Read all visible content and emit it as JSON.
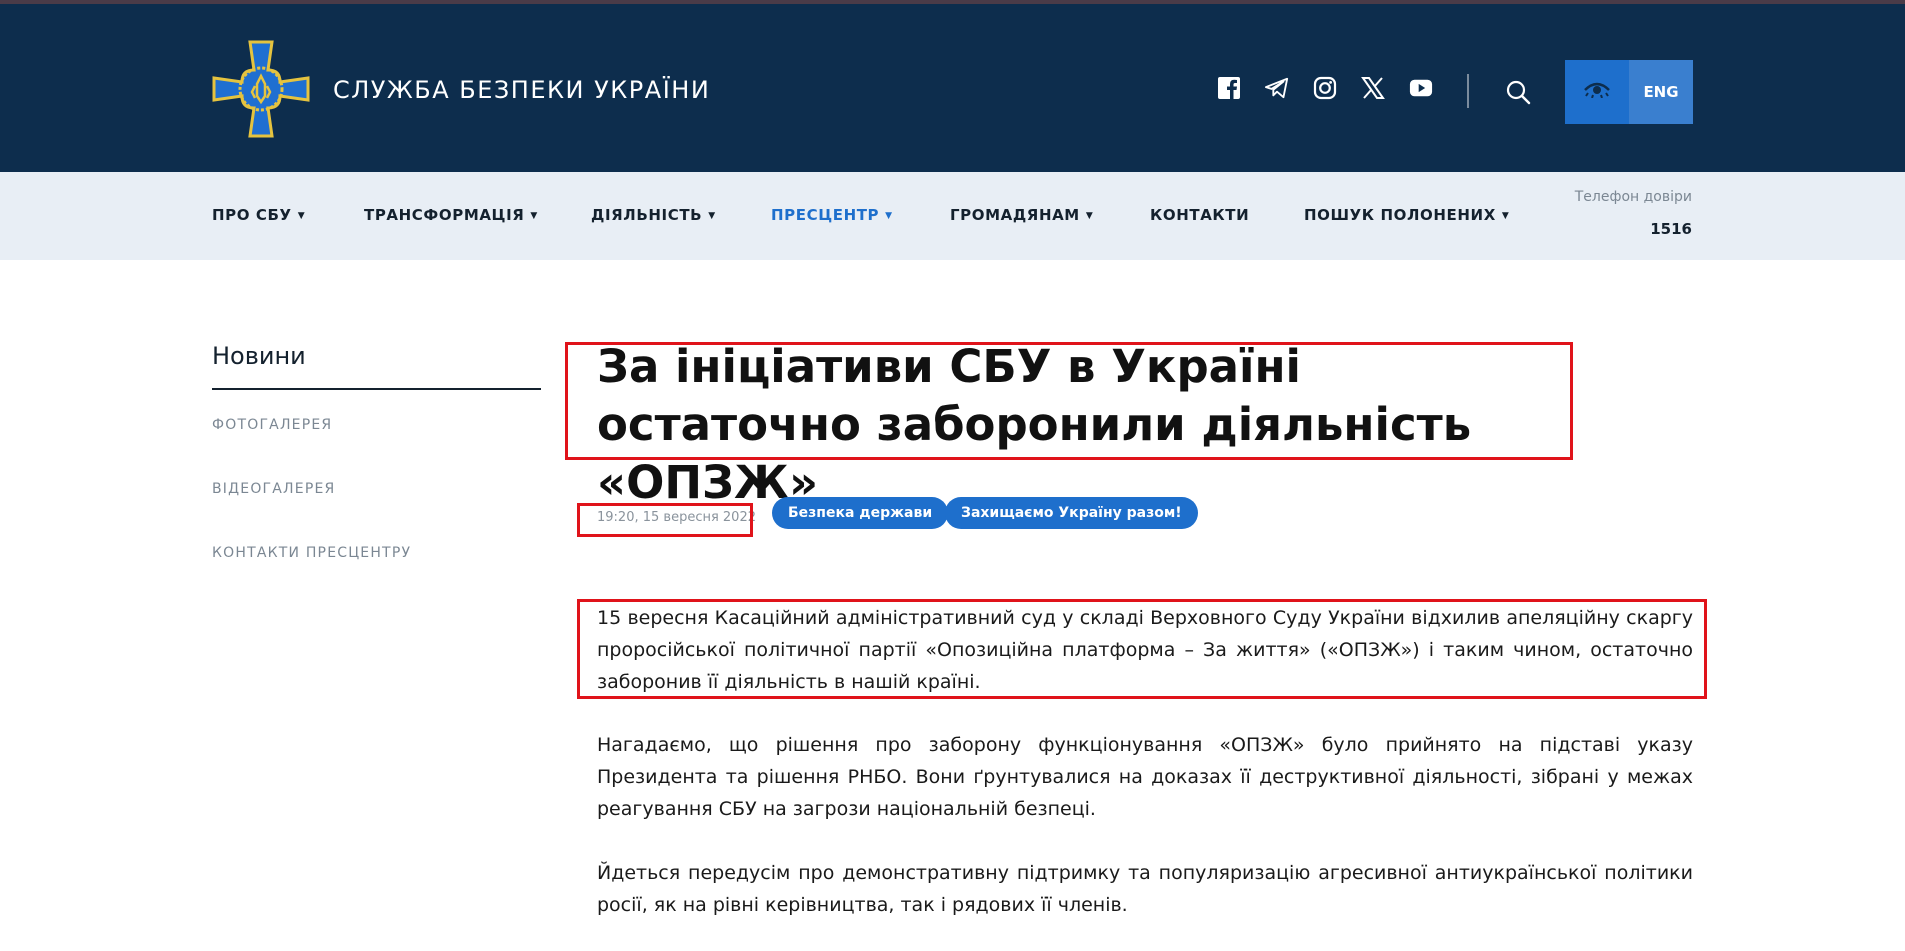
{
  "header": {
    "site_title": "СЛУЖБА БЕЗПЕКИ УКРАЇНИ",
    "logo_icon": "sbu-emblem-icon",
    "socials": [
      "facebook-icon",
      "telegram-icon",
      "instagram-icon",
      "x-icon",
      "youtube-icon"
    ],
    "search_icon": "search-icon",
    "accessibility_icon": "eye-icon",
    "lang_label": "ENG",
    "colors": {
      "header_bg": "#0d2d4d",
      "accent": "#1e6fcc",
      "nav_bg": "#e8eef5",
      "highlight": "#e0131a"
    }
  },
  "nav": {
    "items": [
      {
        "label": "ПРО СБУ",
        "dropdown": true
      },
      {
        "label": "ТРАНСФОРМАЦІЯ",
        "dropdown": true
      },
      {
        "label": "ДІЯЛЬНІСТЬ",
        "dropdown": true
      },
      {
        "label": "ПРЕСЦЕНТР",
        "dropdown": true,
        "active": true
      },
      {
        "label": "ГРОМАДЯНАМ",
        "dropdown": true
      },
      {
        "label": "КОНТАКТИ",
        "dropdown": false
      },
      {
        "label": "ПОШУК ПОЛОНЕНИХ",
        "dropdown": true
      }
    ],
    "trust_label": "Телефон довіри",
    "trust_number": "1516"
  },
  "sidebar": {
    "title": "Новини",
    "links": [
      "ФОТОГАЛЕРЕЯ",
      "ВІДЕОГАЛЕРЕЯ",
      "КОНТАКТИ ПРЕСЦЕНТРУ"
    ]
  },
  "article": {
    "title": "За ініціативи СБУ в Україні остаточно заборонили діяльність «ОПЗЖ»",
    "date": "19:20, 15 вересня 2022",
    "tags": [
      "Безпека держави",
      "Захищаємо Україну разом!"
    ],
    "paragraphs": [
      "15 вересня Касаційний адміністративний суд у складі Верховного Суду України відхилив апеляційну скаргу проросійської політичної партії «Опозиційна платформа – За життя» («ОПЗЖ») і таким чином, остаточно заборонив її діяльність в нашій країні.",
      "Нагадаємо, що рішення про заборону функціонування «ОПЗЖ» було прийнято на підставі указу Президента та рішення РНБО. Вони ґрунтувалися на доказах її деструктивної діяльності, зібрані у межах реагування СБУ на загрози національній безпеці.",
      "Йдеться передусім про демонстративну підтримку та популяризацію агресивної антиукраїнської політики росії, як на рівні керівництва, так і рядових її членів."
    ]
  }
}
